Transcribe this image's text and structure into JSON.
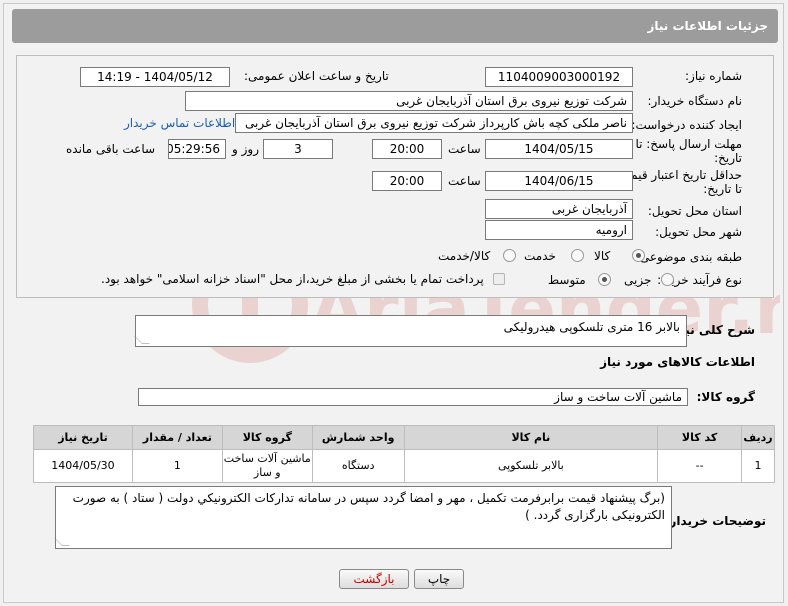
{
  "header": {
    "title": "جزئیات اطلاعات نیاز"
  },
  "fields": {
    "need_number_label": "شماره نیاز:",
    "need_number": "1104009003000192",
    "announce_label": "تاریخ و ساعت اعلان عمومی:",
    "announce_value": "1404/05/12 - 14:19",
    "buyer_org_label": "نام دستگاه خریدار:",
    "buyer_org": "شرکت توزیع نیروی برق استان آذربایجان غربی",
    "creator_label": "ایجاد کننده درخواست:",
    "creator": "ناصر ملکی کچه باش کارپرداز شرکت توزیع نیروی برق استان آذربایجان غربی",
    "contact_link": "اطلاعات تماس خریدار",
    "reply_deadline_label_1": "مهلت ارسال پاسخ: تا",
    "reply_deadline_label_2": "تاریخ:",
    "reply_date": "1404/05/15",
    "time_label": "ساعت",
    "reply_time": "20:00",
    "days_value": "3",
    "days_label": "روز و",
    "remaining_value": "05:29:56",
    "remaining_label": "ساعت باقی مانده",
    "price_validity_label_1": "حداقل تاریخ اعتبار قیمت:",
    "price_validity_label_2": "تا تاریخ:",
    "price_date": "1404/06/15",
    "price_time": "20:00",
    "province_label": "استان محل تحویل:",
    "province": "آذربایجان غربی",
    "city_label": "شهر محل تحویل:",
    "city": "ارومیه",
    "category_label": "طبقه بندی موضوعی:",
    "category_options": [
      "کالا",
      "خدمت",
      "کالا/خدمت"
    ],
    "category_selected": "کالا",
    "process_label": "نوع فرآیند خرید :",
    "process_options": [
      "جزیی",
      "متوسط"
    ],
    "process_selected": "متوسط",
    "payment_note": "پرداخت تمام یا بخشی از مبلغ خرید،از محل \"اسناد خزانه اسلامی\" خواهد بود."
  },
  "description": {
    "label": "شرح کلی نیاز:",
    "value": "بالابر 16 متری تلسکوپی هیدرولیکی"
  },
  "goods": {
    "section_title": "اطلاعات کالاهای مورد نیاز",
    "group_label": "گروه کالا:",
    "group_value": "ماشین آلات ساخت و ساز",
    "columns": [
      "ردیف",
      "کد کالا",
      "نام کالا",
      "واحد شمارش",
      "گروه کالا",
      "تعداد / مقدار",
      "تاریخ نیاز"
    ],
    "rows": [
      {
        "row": "1",
        "code": "--",
        "name": "بالابر تلسکوپی",
        "unit": "دستگاه",
        "group": "ماشین آلات ساخت و ساز",
        "qty": "1",
        "date": "1404/05/30"
      }
    ]
  },
  "buyer_notes": {
    "label": "توضیحات خریدار:",
    "value": "(برگ پیشنهاد قیمت برابرفرمت تکمیل ، مهر و امضا گردد سپس در سامانه تداركات الكترونيكي دولت ( ستاد ) به صورت الکترونیکی  بارگزاری گردد. )"
  },
  "buttons": {
    "print": "چاپ",
    "back": "بازگشت"
  },
  "watermark": {
    "text": "AriaTender.net"
  },
  "colors": {
    "header_bg": "#9c9c9c",
    "link": "#1a5fb4",
    "back_button_text": "#cc0000",
    "watermark": "#c0392b"
  }
}
